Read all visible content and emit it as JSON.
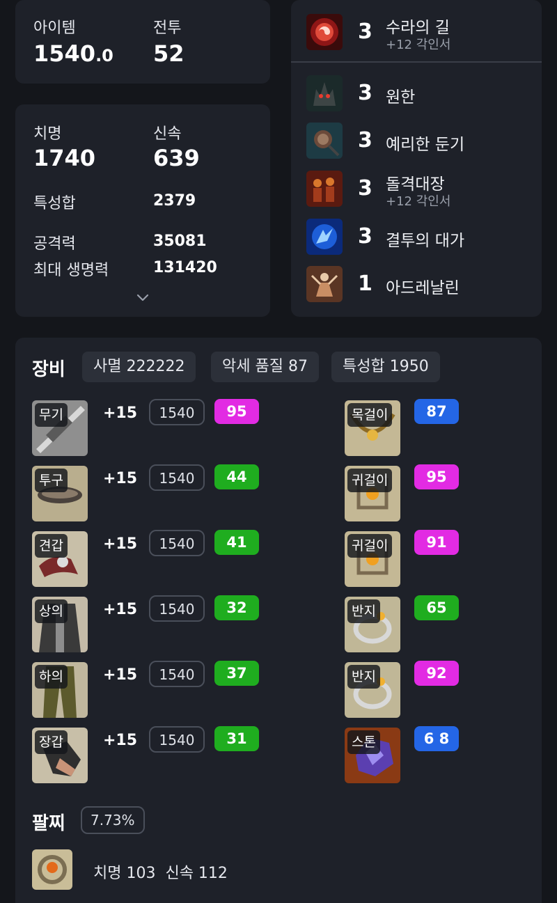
{
  "summary": {
    "item_label": "아이템",
    "item_value": "1540",
    "item_value_decimal": ".0",
    "combat_label": "전투",
    "combat_value": "52"
  },
  "stats": {
    "crit_label": "치명",
    "crit_value": "1740",
    "swift_label": "신속",
    "swift_value": "639",
    "total_label": "특성합",
    "total_value": "2379",
    "attack_label": "공격력",
    "attack_value": "35081",
    "hp_label": "최대 생명력",
    "hp_value": "131420",
    "expand_icon": "chevron-down-icon"
  },
  "engravings": [
    {
      "level": "3",
      "name": "수라의 길",
      "sub": "+12 각인서",
      "icon": "crimson-swirl-icon"
    },
    {
      "level": "3",
      "name": "원한",
      "sub": "",
      "icon": "demon-head-icon"
    },
    {
      "level": "3",
      "name": "예리한 둔기",
      "sub": "",
      "icon": "spiked-mace-icon"
    },
    {
      "level": "3",
      "name": "돌격대장",
      "sub": "+12 각인서",
      "icon": "charging-warriors-icon"
    },
    {
      "level": "3",
      "name": "결투의 대가",
      "sub": "",
      "icon": "blue-duel-icon"
    },
    {
      "level": "1",
      "name": "아드레날린",
      "sub": "",
      "icon": "adrenaline-figure-icon"
    }
  ],
  "equipment": {
    "title": "장비",
    "chips": [
      "사멸 222222",
      "악세 품질 87",
      "특성합 1950"
    ],
    "gear": [
      {
        "slot": "무기",
        "enhance": "+15",
        "ilvl": "1540",
        "quality": "95",
        "quality_color": "#e22be3",
        "icon": "weapon-icon"
      },
      {
        "slot": "투구",
        "enhance": "+15",
        "ilvl": "1540",
        "quality": "44",
        "quality_color": "#1fad1f",
        "icon": "helmet-icon"
      },
      {
        "slot": "견갑",
        "enhance": "+15",
        "ilvl": "1540",
        "quality": "41",
        "quality_color": "#1fad1f",
        "icon": "shoulder-icon"
      },
      {
        "slot": "상의",
        "enhance": "+15",
        "ilvl": "1540",
        "quality": "32",
        "quality_color": "#1fad1f",
        "icon": "chest-icon"
      },
      {
        "slot": "하의",
        "enhance": "+15",
        "ilvl": "1540",
        "quality": "37",
        "quality_color": "#1fad1f",
        "icon": "pants-icon"
      },
      {
        "slot": "장갑",
        "enhance": "+15",
        "ilvl": "1540",
        "quality": "31",
        "quality_color": "#1fad1f",
        "icon": "glove-icon"
      }
    ],
    "accessories": [
      {
        "slot": "목걸이",
        "quality": "87",
        "quality_color": "#2466e6",
        "icon": "necklace-icon"
      },
      {
        "slot": "귀걸이",
        "quality": "95",
        "quality_color": "#e22be3",
        "icon": "earring-icon"
      },
      {
        "slot": "귀걸이",
        "quality": "91",
        "quality_color": "#e22be3",
        "icon": "earring-icon"
      },
      {
        "slot": "반지",
        "quality": "65",
        "quality_color": "#1fad1f",
        "icon": "ring-icon"
      },
      {
        "slot": "반지",
        "quality": "92",
        "quality_color": "#e22be3",
        "icon": "ring-icon"
      },
      {
        "slot": "스톤",
        "quality": "6 8",
        "quality_color": "#2466e6",
        "icon": "ability-stone-icon"
      }
    ]
  },
  "bracelet": {
    "title": "팔찌",
    "percent": "7.73%",
    "stats": "치명 103  신속 112",
    "icon": "bracelet-icon"
  }
}
